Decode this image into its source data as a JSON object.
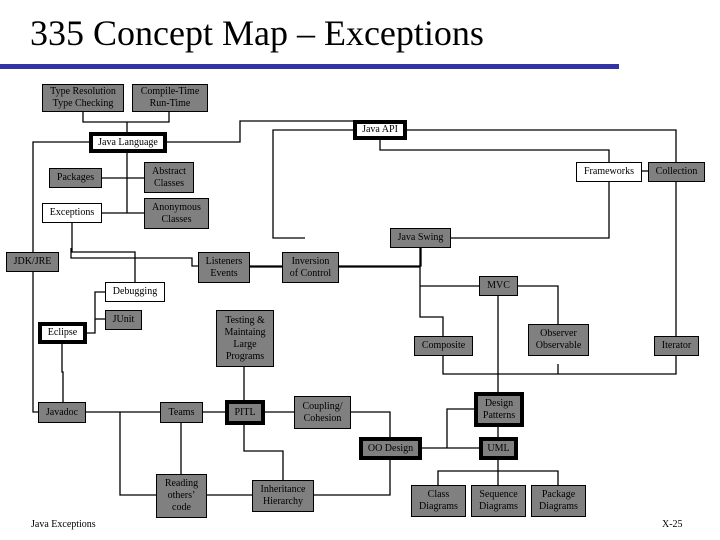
{
  "title": "335 Concept Map – Exceptions",
  "colors": {
    "accent_rule": "#3333a6",
    "node_gray": "#808080",
    "node_white": "#ffffff"
  },
  "nodes": {
    "type_resolution": "Type Resolution\nType Checking",
    "compile_time": "Compile-Time\nRun-Time",
    "java_language": "Java Language",
    "java_api": "Java API",
    "packages": "Packages",
    "abstract_classes": "Abstract\nClasses",
    "exceptions": "Exceptions",
    "anonymous_classes": "Anonymous\nClasses",
    "frameworks": "Frameworks",
    "collection": "Collection",
    "java_swing": "Java Swing",
    "jdk_jre": "JDK/JRE",
    "listeners_events": "Listeners\nEvents",
    "inversion_of_control": "Inversion\nof Control",
    "debugging": "Debugging",
    "mvc": "MVC",
    "junit": "JUnit",
    "eclipse": "Eclipse",
    "testing": "Testing &\nMaintaing\nLarge\nPrograms",
    "composite": "Composite",
    "observer": "Observer\nObservable",
    "iterator": "Iterator",
    "javadoc": "Javadoc",
    "teams": "Teams",
    "pitl": "PITL",
    "coupling": "Coupling/\nCohesion",
    "design_patterns": "Design\nPatterns",
    "oo_design": "OO Design",
    "uml": "UML",
    "reading_code": "Reading\nothers’\ncode",
    "inheritance": "Inheritance\nHierarchy",
    "class_diagrams": "Class\nDiagrams",
    "sequence_diagrams": "Sequence\nDiagrams",
    "package_diagrams": "Package\nDiagrams"
  },
  "footer": {
    "left": "Java Exceptions",
    "right": "X-25"
  }
}
